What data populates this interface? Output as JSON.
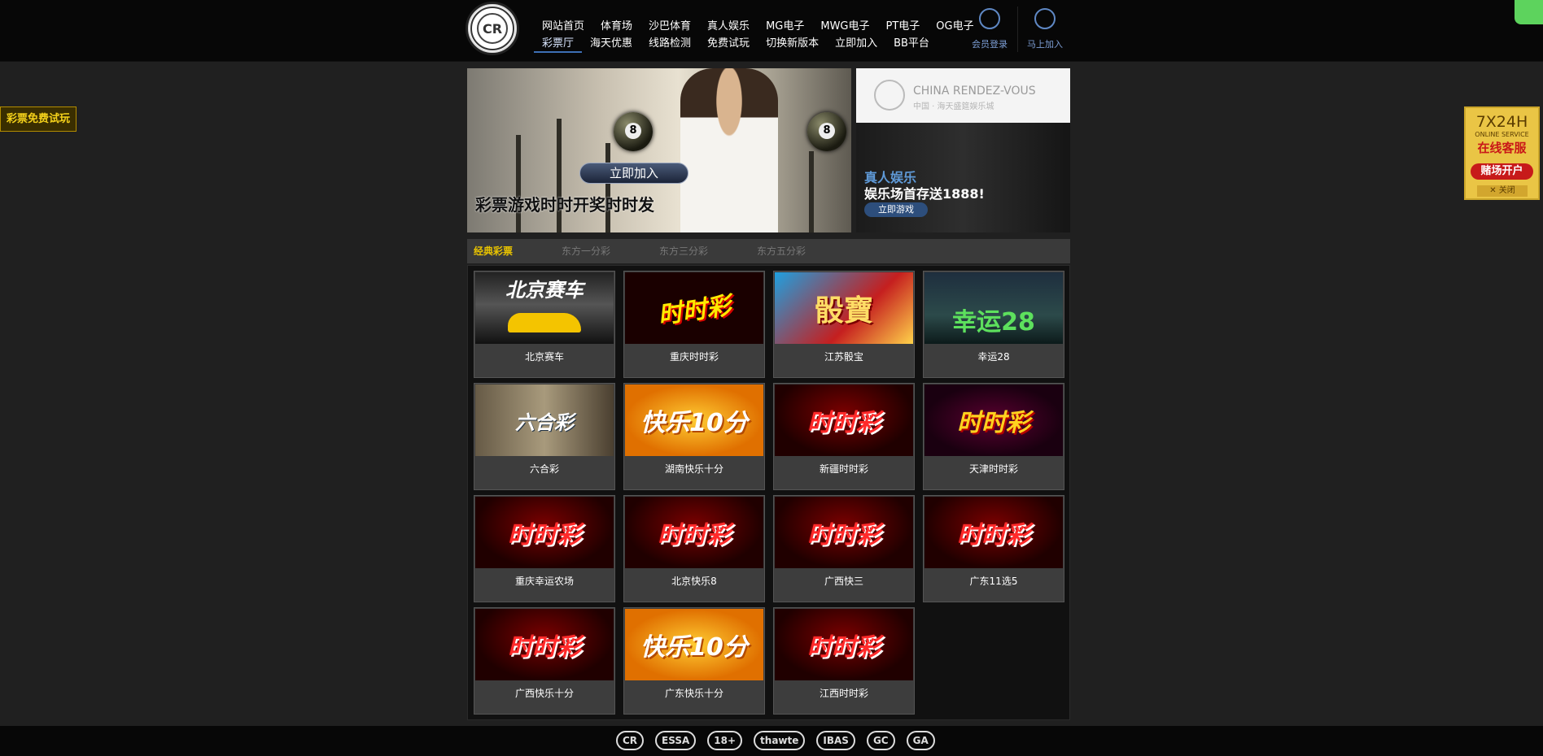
{
  "header": {
    "nav_row1": [
      "网站首页",
      "体育场",
      "沙巴体育",
      "真人娱乐",
      "MG电子",
      "MWG电子",
      "PT电子",
      "OG电子"
    ],
    "nav_row2": [
      "彩票厅",
      "海天优惠",
      "线路检测",
      "免费试玩",
      "切换新版本",
      "立即加入",
      "BB平台"
    ],
    "member_login": "会员登录",
    "join_now": "马上加入",
    "logo_text": "CHINA RENDEZ-VOUS"
  },
  "banner": {
    "join_button": "立即加入",
    "slogan": "彩票游戏时时开奖时时发",
    "ball_number": "8"
  },
  "side_banner": {
    "brand": "CHINA RENDEZ-VOUS",
    "sub": "中国 · 海天盛筵娱乐城",
    "title": "真人娱乐",
    "promo": "娱乐场首存送1888!",
    "button": "立即游戏"
  },
  "tabs": [
    "经典彩票",
    "东方一分彩",
    "东方三分彩",
    "东方五分彩"
  ],
  "games": [
    {
      "name": "北京赛车",
      "thumb": "北京赛车",
      "style": "t-bj"
    },
    {
      "name": "重庆时时彩",
      "thumb": "时时彩",
      "style": "t-cq"
    },
    {
      "name": "江苏骰宝",
      "thumb": "骰寶",
      "style": "t-js"
    },
    {
      "name": "幸运28",
      "thumb": "幸运28",
      "style": "t-28"
    },
    {
      "name": "六合彩",
      "thumb": "六合彩",
      "style": "t-lhc"
    },
    {
      "name": "湖南快乐十分",
      "thumb": "快乐10分",
      "style": "t-kl"
    },
    {
      "name": "新疆时时彩",
      "thumb": "时时彩",
      "style": "t-ssc"
    },
    {
      "name": "天津时时彩",
      "thumb": "时时彩",
      "style": "t-tj"
    },
    {
      "name": "重庆幸运农场",
      "thumb": "时时彩",
      "style": "t-ssc"
    },
    {
      "name": "北京快乐8",
      "thumb": "时时彩",
      "style": "t-ssc"
    },
    {
      "name": "广西快三",
      "thumb": "时时彩",
      "style": "t-ssc"
    },
    {
      "name": "广东11选5",
      "thumb": "时时彩",
      "style": "t-ssc"
    },
    {
      "name": "广西快乐十分",
      "thumb": "时时彩",
      "style": "t-ssc"
    },
    {
      "name": "广东快乐十分",
      "thumb": "快乐10分",
      "style": "t-kl"
    },
    {
      "name": "江西时时彩",
      "thumb": "时时彩",
      "style": "t-ssc"
    }
  ],
  "footer_logos": [
    "CR",
    "ESSA",
    "18+",
    "thawte",
    "IBAS",
    "GC",
    "GA"
  ],
  "float_left": "彩票免费试玩",
  "float_right": {
    "hours": "7X24H",
    "service_en": "ONLINE SERVICE",
    "service": "在线客服",
    "button": "赌场开户",
    "close": "✕ 关闭"
  }
}
